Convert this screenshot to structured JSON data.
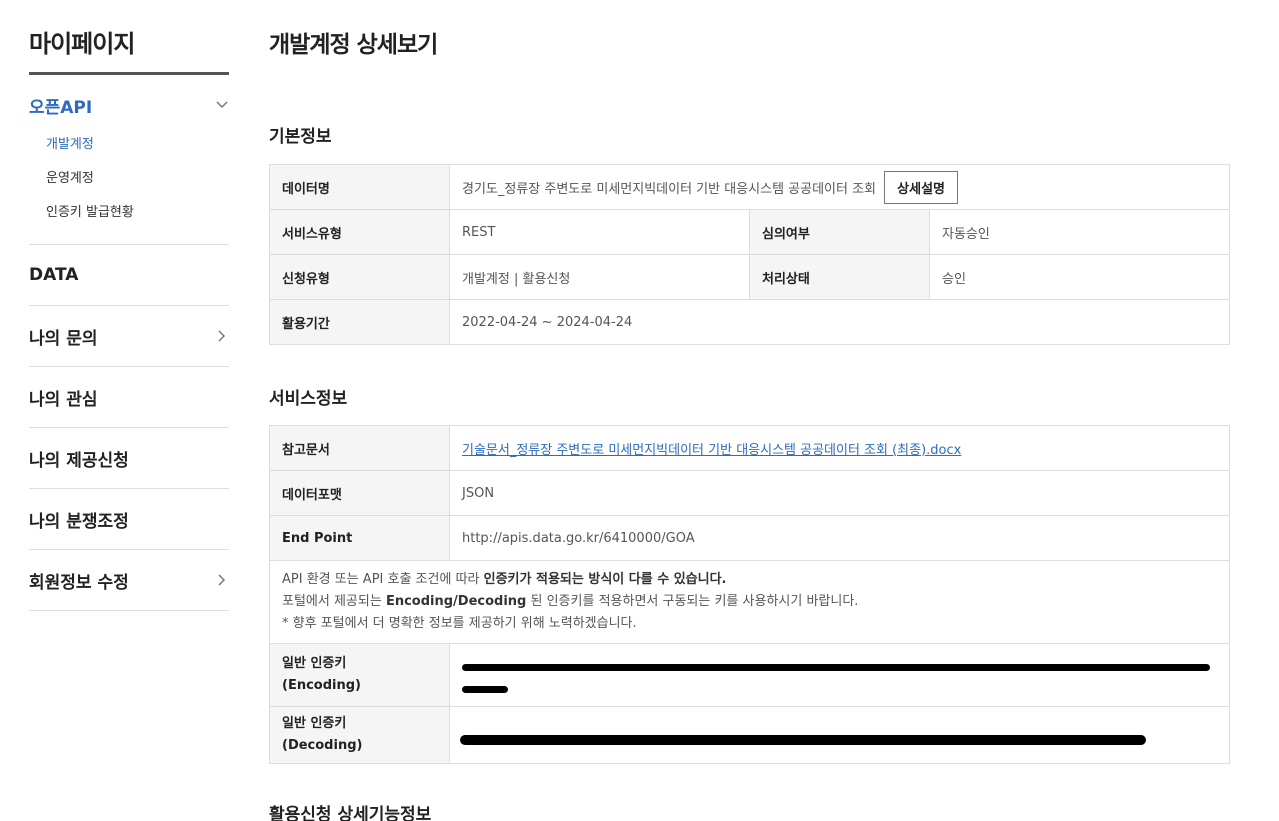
{
  "sidebar": {
    "title": "마이페이지",
    "open_section": {
      "label": "오픈API",
      "items": [
        "개발계정",
        "운영계정",
        "인증키 발급현황"
      ]
    },
    "sections": [
      {
        "label": "DATA"
      },
      {
        "label": "나의 문의"
      },
      {
        "label": "나의 관심"
      },
      {
        "label": "나의 제공신청"
      },
      {
        "label": "나의 분쟁조정"
      },
      {
        "label": "회원정보 수정"
      }
    ]
  },
  "page": {
    "title": "개발계정 상세보기"
  },
  "basic": {
    "title": "기본정보",
    "data_name_label": "데이터명",
    "data_name_value": "경기도_정류장 주변도로 미세먼지빅데이터 기반 대응시스템 공공데이터 조회",
    "detail_button": "상세설명",
    "service_type_label": "서비스유형",
    "service_type_value": "REST",
    "review_label": "심의여부",
    "review_value": "자동승인",
    "apply_type_label": "신청유형",
    "apply_type_value": "개발계정 | 활용신청",
    "status_label": "처리상태",
    "status_value": "승인",
    "period_label": "활용기간",
    "period_value": "2022-04-24 ~ 2024-04-24"
  },
  "service": {
    "title": "서비스정보",
    "ref_doc_label": "참고문서",
    "ref_doc_value": "기술문서_정류장 주변도로 미세먼지빅데이터 기반 대응시스템 공공데이터 조회 (최종).docx",
    "format_label": "데이터포맷",
    "format_value": "JSON",
    "endpoint_label": "End Point",
    "endpoint_value": "http://apis.data.go.kr/6410000/GOA",
    "notice_line1_a": "API 환경 또는 API 호출 조건에 따라 ",
    "notice_line1_b": "인증키가 적용되는 방식이 다를 수 있습니다.",
    "notice_line2_a": "포털에서 제공되는 ",
    "notice_line2_b": "Encoding/Decoding",
    "notice_line2_c": " 된 인증키를 적용하면서 구동되는 키를 사용하시기 바랍니다.",
    "notice_line3": "* 향후 포털에서 더 명확한 정보를 제공하기 위해 노력하겠습니다.",
    "enc_label_1": "일반 인증키",
    "enc_label_2": "(Encoding)",
    "dec_label_1": "일반 인증키",
    "dec_label_2": "(Decoding)"
  },
  "detail": {
    "title": "활용신청 상세기능정보"
  }
}
